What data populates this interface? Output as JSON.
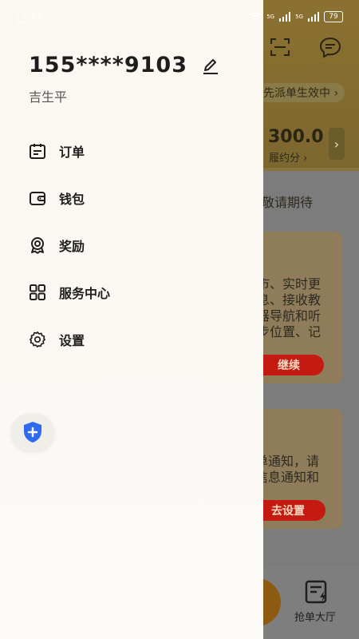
{
  "status_bar": {
    "time": "15:55",
    "network": "5G",
    "battery": "79"
  },
  "drawer": {
    "phone": "155****9103",
    "name": "吉生平",
    "menu": [
      {
        "label": "订单",
        "icon": "order-icon"
      },
      {
        "label": "钱包",
        "icon": "wallet-icon"
      },
      {
        "label": "奖励",
        "icon": "award-icon"
      },
      {
        "label": "服务中心",
        "icon": "service-center-icon"
      },
      {
        "label": "设置",
        "icon": "settings-icon"
      }
    ]
  },
  "background": {
    "banner_text": "先派单生效中",
    "score_value": "300.0",
    "score_label": "履约分",
    "notice_1": "敬请期待",
    "card_text_1": [
      "市、实时更",
      "息、接收教",
      "器导航和听",
      "步位置、记"
    ],
    "continue_label": "继续",
    "card_text_2": [
      "单通知，请",
      "信息通知和"
    ],
    "go_settings_label": "去设置",
    "bottom_tab_label": "抢单大厅"
  },
  "colors": {
    "accent_red": "#c51a12",
    "shield_blue": "#2f6bf0"
  }
}
